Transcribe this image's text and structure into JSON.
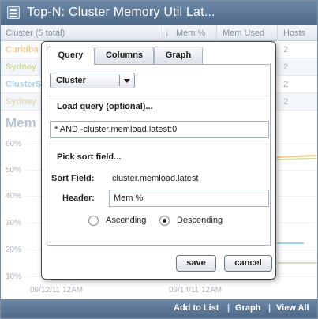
{
  "window": {
    "title": "Top-N: Cluster Memory Util Lat..."
  },
  "table": {
    "headers": {
      "cluster": "Cluster (5 total)",
      "sort_arrow": "↓",
      "mem_pct": "Mem %",
      "mem_used": "Mem Used",
      "hosts": "Hosts"
    },
    "rows": [
      {
        "cluster": "Curitiba",
        "hosts": "2",
        "color": "#f0c890"
      },
      {
        "cluster": "Sydney",
        "hosts": "2",
        "color": "#cfd99a"
      },
      {
        "cluster": "ClusterS",
        "hosts": "2",
        "color": "#a9d1ec"
      },
      {
        "cluster": "Sydney",
        "hosts": "2",
        "color": "#dcdcbc"
      }
    ]
  },
  "chart_data": {
    "type": "line",
    "title": "Mem",
    "y_ticks": [
      "60%",
      "50%",
      "40%",
      "30%",
      "20%",
      "10%"
    ],
    "x_ticks": [
      "09/12/11 12AM",
      "09/14/11 12AM"
    ]
  },
  "modal": {
    "tabs": [
      {
        "label": "Query",
        "active": true
      },
      {
        "label": "Columns",
        "active": false
      },
      {
        "label": "Graph",
        "active": false
      }
    ],
    "entity_select": {
      "value": "Cluster"
    },
    "load_query_label": "Load query (optional)...",
    "query_value": "* AND -cluster.memload.latest:0",
    "pick_sort_label": "Pick sort field...",
    "sort_field_label": "Sort Field:",
    "sort_field_value": "cluster.memload.latest",
    "header_label": "Header:",
    "header_value": "Mem %",
    "order": {
      "ascending": "Ascending",
      "descending": "Descending",
      "selected": "descending"
    },
    "save": "save",
    "cancel": "cancel"
  },
  "footer": {
    "add_to_list": "Add to List",
    "graph": "Graph",
    "view_all": "View All"
  },
  "colors": {
    "titlebar": "#5a7394",
    "modal_border": "#444444"
  }
}
